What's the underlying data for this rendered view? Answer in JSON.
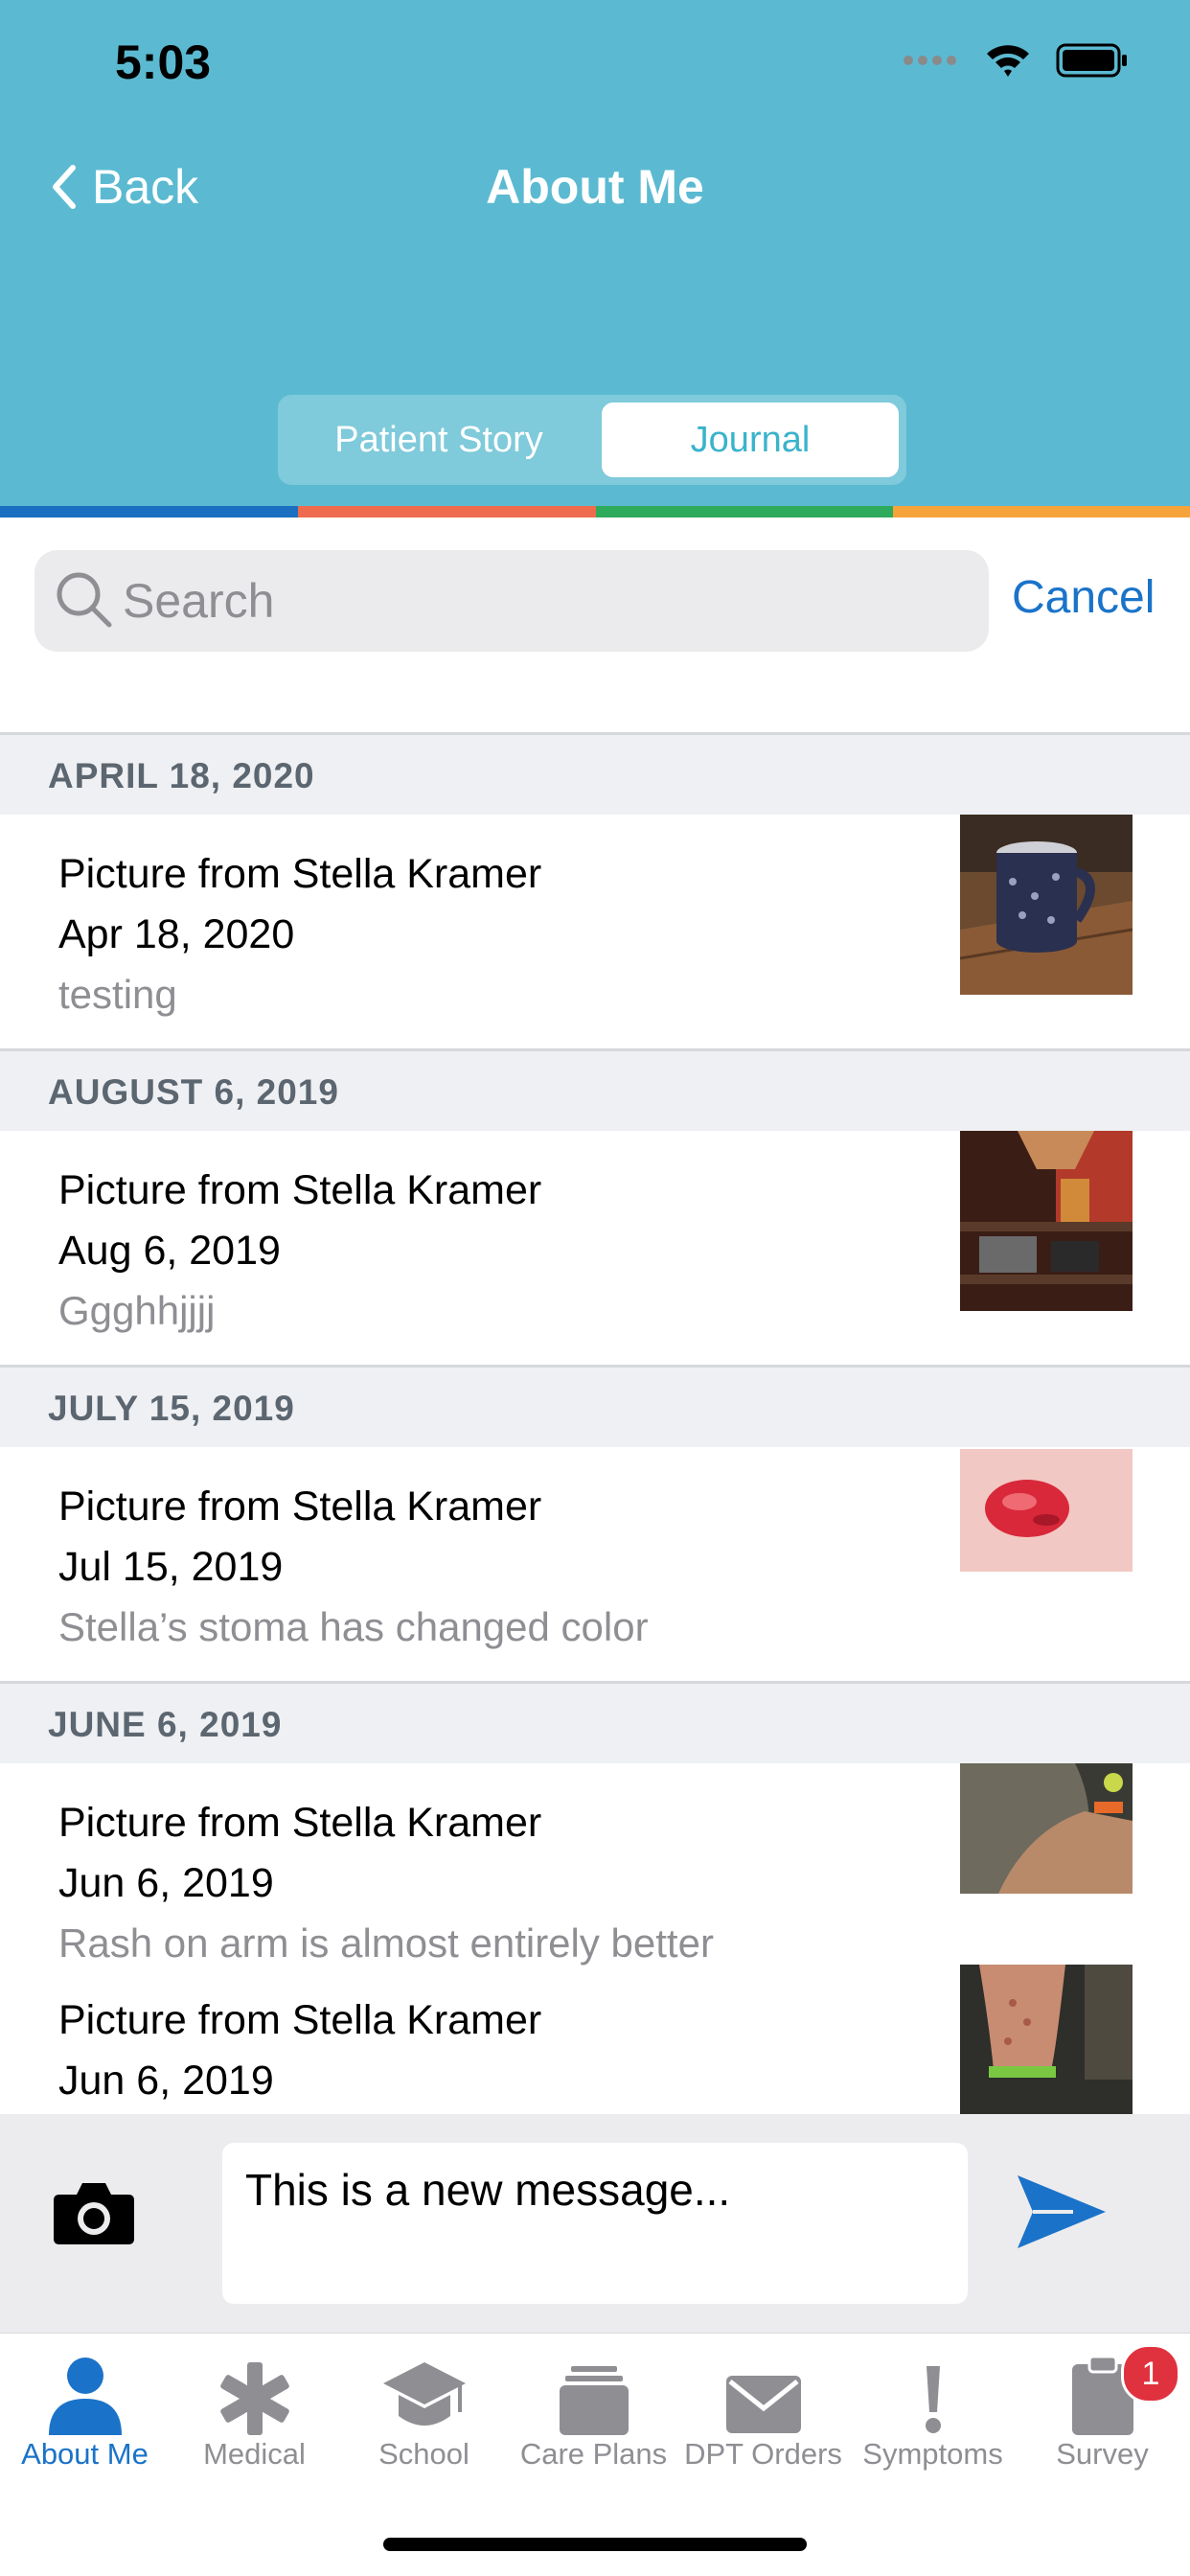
{
  "status_bar": {
    "time": "5:03",
    "icons": [
      "signal-dots-icon",
      "wifi-icon",
      "battery-icon"
    ]
  },
  "nav": {
    "back_label": "Back",
    "title": "About Me"
  },
  "segments": {
    "story_label": "Patient Story",
    "journal_label": "Journal",
    "selected": "Journal"
  },
  "accent_colors": {
    "header": "#5bbad1",
    "bar": [
      "#1a6fc1",
      "#ee6b4d",
      "#2eaa5c",
      "#f6a33a"
    ],
    "link": "#1a73c9"
  },
  "search": {
    "placeholder": "Search",
    "value": "",
    "cancel_label": "Cancel"
  },
  "journal": {
    "sections": [
      {
        "title": "APRIL 18, 2020",
        "entries": [
          {
            "title": "Picture from Stella Kramer",
            "date": "Apr 18, 2020",
            "note": "testing",
            "thumbnail": "mug-photo"
          }
        ]
      },
      {
        "title": "AUGUST 6, 2019",
        "entries": [
          {
            "title": "Picture from Stella Kramer",
            "date": "Aug 6, 2019",
            "note": "Ggghhjjjj",
            "thumbnail": "shelf-photo"
          }
        ]
      },
      {
        "title": "JULY 15, 2019",
        "entries": [
          {
            "title": "Picture from Stella Kramer",
            "date": "Jul 15, 2019",
            "note": "Stella’s stoma has changed color",
            "thumbnail": "stoma-photo"
          }
        ]
      },
      {
        "title": "JUNE 6, 2019",
        "entries": [
          {
            "title": "Picture from Stella Kramer",
            "date": "Jun 6, 2019",
            "note": "Rash on arm is almost entirely better",
            "thumbnail": "arm-photo"
          },
          {
            "title": "Picture from Stella Kramer",
            "date": "Jun 6, 2019",
            "note": "",
            "thumbnail": "leg-photo"
          }
        ]
      }
    ]
  },
  "composer": {
    "message": "This is a new message...",
    "camera_icon": "camera-icon",
    "send_icon": "send-icon"
  },
  "tabbar": {
    "tabs": [
      {
        "label": "About Me",
        "icon": "person-icon",
        "active": true
      },
      {
        "label": "Medical",
        "icon": "asterisk-icon"
      },
      {
        "label": "School",
        "icon": "graduation-cap-icon"
      },
      {
        "label": "Care Plans",
        "icon": "stack-icon"
      },
      {
        "label": "DPT Orders",
        "icon": "envelope-icon"
      },
      {
        "label": "Symptoms",
        "icon": "exclamation-icon"
      },
      {
        "label": "Survey",
        "icon": "clipboard-icon",
        "badge": "1"
      }
    ]
  }
}
